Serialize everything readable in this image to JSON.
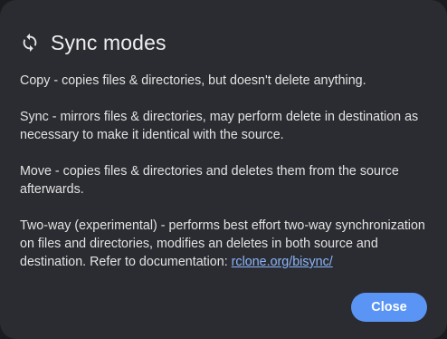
{
  "dialog": {
    "title": "Sync modes",
    "icon": "sync-icon",
    "paragraphs": {
      "copy": "Copy - copies files & directories, but doesn't delete anything.",
      "sync": "Sync - mirrors files & directories, may perform delete in destination as necessary to make it identical with the source.",
      "move": "Move - copies files & directories and deletes them from the source afterwards.",
      "twoway": "Two-way (experimental) - performs best effort two-way synchronization on files and directories, modifies an deletes in both source and destination. Refer to documentation: "
    },
    "doc_link": "rclone.org/bisync/",
    "close_label": "Close"
  },
  "colors": {
    "dialog_bg": "#2b2c31",
    "accent": "#5a95f5",
    "link": "#8ab4f8"
  }
}
